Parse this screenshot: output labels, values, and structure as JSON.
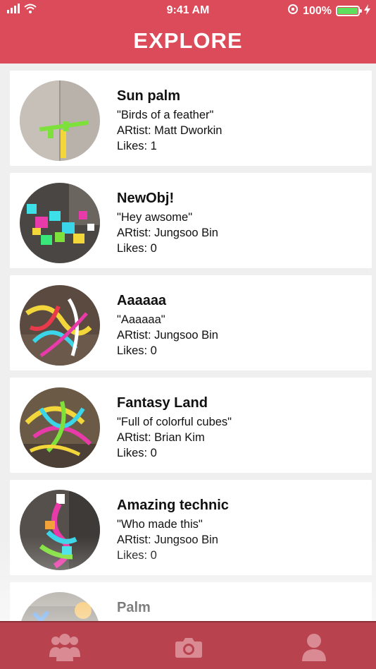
{
  "status_bar": {
    "time": "9:41 AM",
    "battery_percent": "100%",
    "battery_level": 1.0
  },
  "header": {
    "title": "EXPLORE"
  },
  "posts": [
    {
      "title": "Sun palm",
      "quote": "\"Birds of a feather\"",
      "artist": "ARtist: Matt Dworkin",
      "likes": "Likes: 1"
    },
    {
      "title": "NewObj!",
      "quote": "\"Hey awsome\"",
      "artist": "ARtist: Jungsoo Bin",
      "likes": "Likes: 0"
    },
    {
      "title": "Aaaaaa",
      "quote": "\"Aaaaaa\"",
      "artist": "ARtist: Jungsoo Bin",
      "likes": "Likes: 0"
    },
    {
      "title": "Fantasy Land",
      "quote": "\"Full of colorful cubes\"",
      "artist": "ARtist: Brian Kim",
      "likes": "Likes: 0"
    },
    {
      "title": "Amazing technic",
      "quote": "\"Who made this\"",
      "artist": "ARtist: Jungsoo Bin",
      "likes": "Likes: 0"
    },
    {
      "title": "Palm"
    }
  ],
  "tab_bar": {
    "tabs": [
      {
        "icon": "users-icon"
      },
      {
        "icon": "camera-icon"
      },
      {
        "icon": "profile-icon"
      }
    ]
  },
  "colors": {
    "header_bg": "#dc4b5a",
    "tab_bar_bg": "#b8434f",
    "list_bg": "#efefef",
    "card_bg": "#ffffff",
    "battery": "#5ee05e"
  }
}
